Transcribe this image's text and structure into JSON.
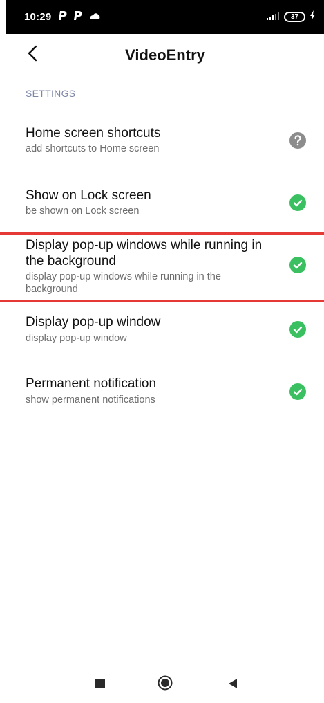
{
  "status_bar": {
    "time": "10:29",
    "left_icons": [
      "p-icon",
      "p-icon",
      "cloud-icon"
    ],
    "battery_level": "37",
    "icons_right": [
      "signal-icon",
      "battery-icon",
      "charging-bolt-icon"
    ]
  },
  "app_bar": {
    "back_icon": "chevron-left-icon",
    "title": "VideoEntry"
  },
  "section": {
    "header": "SETTINGS"
  },
  "settings": [
    {
      "title": "Home screen shortcuts",
      "subtitle": "add shortcuts to Home screen",
      "status_icon": "question-icon",
      "status": "unknown"
    },
    {
      "title": "Show on Lock screen",
      "subtitle": "be shown on Lock screen",
      "status_icon": "check-icon",
      "status": "enabled"
    },
    {
      "title": "Display pop-up windows while running in the background",
      "subtitle": "display pop-up windows while running in the background",
      "status_icon": "check-icon",
      "status": "enabled"
    },
    {
      "title": "Display pop-up window",
      "subtitle": "display pop-up window",
      "status_icon": "check-icon",
      "status": "enabled"
    },
    {
      "title": "Permanent notification",
      "subtitle": "show permanent notifications",
      "status_icon": "check-icon",
      "status": "enabled"
    }
  ],
  "nav_bar": {
    "buttons": [
      "recents-square-icon",
      "home-circle-icon",
      "back-triangle-icon"
    ]
  },
  "colors": {
    "status_bar_bg": "#000000",
    "check_green": "#3ac060",
    "question_gray": "#8c8c8c",
    "section_header": "#7d86a6",
    "highlight_red": "#e53935"
  }
}
